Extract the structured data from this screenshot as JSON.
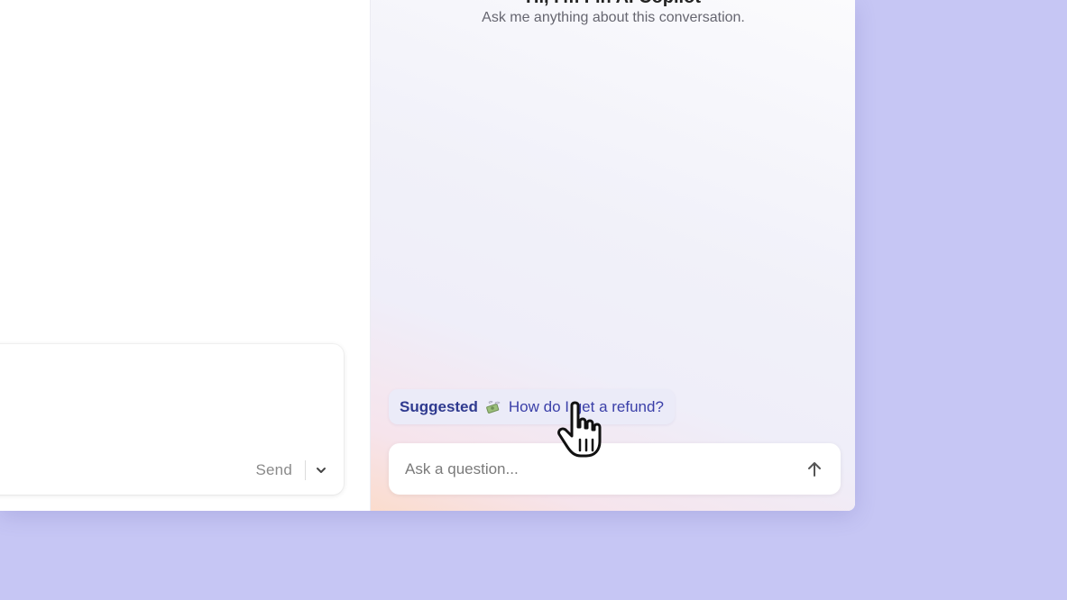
{
  "composer": {
    "send_label": "Send",
    "options_icon": "chevron-down-icon"
  },
  "copilot": {
    "title": "Hi, I'm Fin AI Copilot",
    "subtitle": "Ask me anything about this conversation.",
    "suggested": {
      "label": "Suggested",
      "icon": "money-with-wings-icon",
      "text": "How do I get a refund?"
    },
    "question_input": {
      "placeholder": "Ask a question...",
      "value": ""
    },
    "submit_icon": "arrow-up-icon"
  },
  "colors": {
    "backdrop": "#c6c6f4",
    "accent": "#2f3a8f",
    "chip_background": "#ebebf8"
  }
}
